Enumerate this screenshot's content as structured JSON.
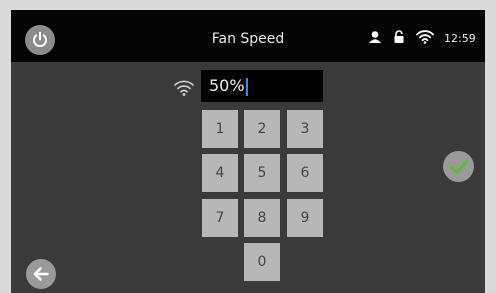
{
  "header": {
    "title": "Fan Speed",
    "time": "12:59",
    "icons": [
      "power-icon",
      "user-icon",
      "lock-icon",
      "wifi-icon"
    ]
  },
  "input": {
    "value": "50%"
  },
  "keypad": {
    "keys": [
      "1",
      "2",
      "3",
      "4",
      "5",
      "6",
      "7",
      "8",
      "9",
      "0"
    ]
  },
  "actions": {
    "confirm_icon": "check-icon",
    "back_icon": "back-arrow-icon"
  },
  "colors": {
    "background": "#3a3a3a",
    "topbar": "#050505",
    "accent_check": "#5cbc33",
    "cursor": "#2d8cff",
    "key_face": "#b7b7b7"
  }
}
